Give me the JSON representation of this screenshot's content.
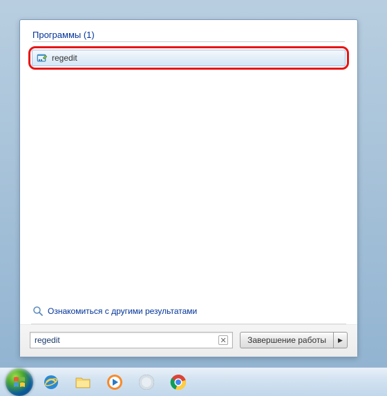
{
  "results": {
    "category_label": "Программы (1)",
    "item": {
      "name": "regedit",
      "icon": "regedit-icon"
    }
  },
  "see_more_label": "Ознакомиться с другими результатами",
  "search": {
    "value": "regedit"
  },
  "shutdown": {
    "label": "Завершение работы"
  },
  "taskbar": {
    "items": [
      {
        "name": "start-orb"
      },
      {
        "name": "internet-explorer-icon"
      },
      {
        "name": "file-explorer-icon"
      },
      {
        "name": "windows-media-player-icon"
      },
      {
        "name": "generic-app-icon"
      },
      {
        "name": "chrome-icon"
      }
    ]
  }
}
